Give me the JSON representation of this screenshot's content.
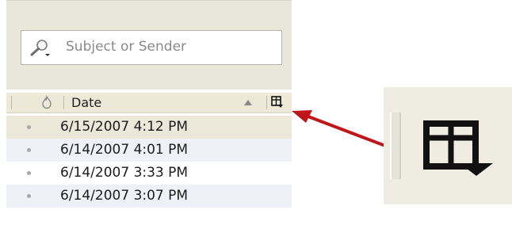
{
  "search": {
    "placeholder": "Subject or Sender"
  },
  "column_header": {
    "date_label": "Date",
    "sort_direction": "ascending",
    "icons": [
      "flame-icon",
      "sort-arrow-icon",
      "field-chooser-icon"
    ]
  },
  "messages": [
    {
      "date": "6/15/2007 4:12 PM",
      "selected": true
    },
    {
      "date": "6/14/2007 4:01 PM",
      "selected": false
    },
    {
      "date": "6/14/2007 3:33 PM",
      "selected": false
    },
    {
      "date": "6/14/2007 3:07 PM",
      "selected": false
    }
  ],
  "annotation": {
    "arrow_color": "#c0161b",
    "magnified_icon": "field-chooser-icon"
  }
}
